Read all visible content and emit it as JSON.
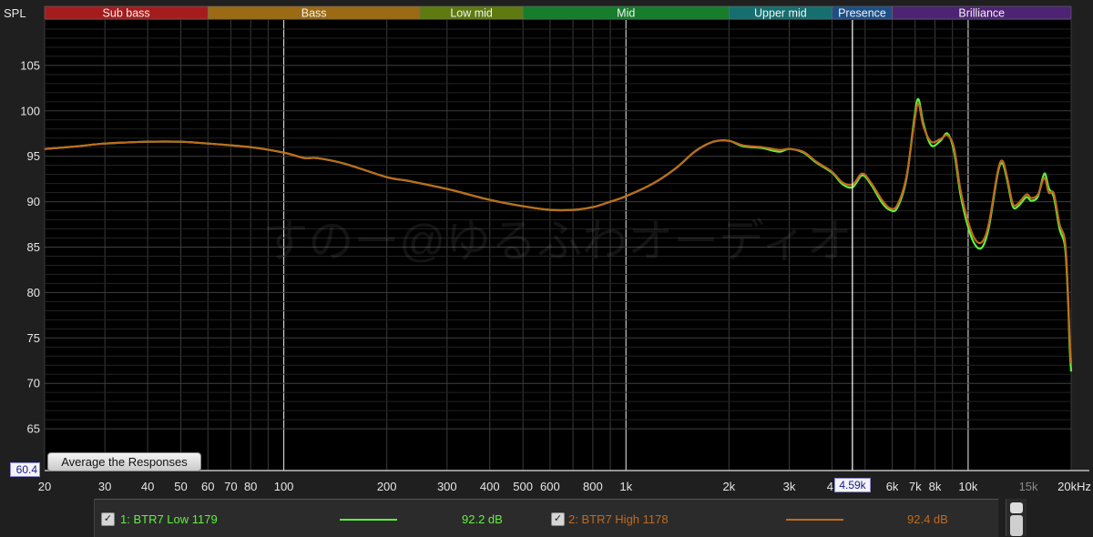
{
  "header": {
    "spl_label": "SPL",
    "bands": [
      {
        "name": "Sub bass",
        "from": 20,
        "to": 60,
        "color": "#a51c1c"
      },
      {
        "name": "Bass",
        "from": 60,
        "to": 250,
        "color": "#9b6a13"
      },
      {
        "name": "Low mid",
        "from": 250,
        "to": 500,
        "color": "#5f7b10"
      },
      {
        "name": "Mid",
        "from": 500,
        "to": 2000,
        "color": "#157d2b"
      },
      {
        "name": "Upper mid",
        "from": 2000,
        "to": 4000,
        "color": "#166f6f"
      },
      {
        "name": "Presence",
        "from": 4000,
        "to": 6000,
        "color": "#1d4f86"
      },
      {
        "name": "Brilliance",
        "from": 6000,
        "to": 20000,
        "color": "#4d2373"
      }
    ]
  },
  "controls": {
    "average_button": "Average the Responses",
    "ymin_value": "60.4",
    "cursor_freq_label": "4.59k",
    "cursor_freq": 4590
  },
  "watermark": "すのー@ゆるふわオーディオ",
  "chart_data": {
    "type": "line",
    "xscale": "log",
    "xlim": [
      20,
      20000
    ],
    "ylim": [
      60.4,
      110
    ],
    "grid": true,
    "x_ticks": [
      {
        "v": 20,
        "label": "20"
      },
      {
        "v": 30,
        "label": "30"
      },
      {
        "v": 40,
        "label": "40"
      },
      {
        "v": 50,
        "label": "50"
      },
      {
        "v": 60,
        "label": "60"
      },
      {
        "v": 70,
        "label": "70"
      },
      {
        "v": 80,
        "label": "80"
      },
      {
        "v": 100,
        "label": "100"
      },
      {
        "v": 200,
        "label": "200"
      },
      {
        "v": 300,
        "label": "300"
      },
      {
        "v": 400,
        "label": "400"
      },
      {
        "v": 500,
        "label": "500"
      },
      {
        "v": 600,
        "label": "600"
      },
      {
        "v": 800,
        "label": "800"
      },
      {
        "v": 1000,
        "label": "1k"
      },
      {
        "v": 2000,
        "label": "2k"
      },
      {
        "v": 3000,
        "label": "3k"
      },
      {
        "v": 4000,
        "label": "4"
      },
      {
        "v": 6000,
        "label": "6k"
      },
      {
        "v": 7000,
        "label": "7k"
      },
      {
        "v": 8000,
        "label": "8k"
      },
      {
        "v": 10000,
        "label": "10k"
      },
      {
        "v": 15000,
        "label": "15k",
        "dim": true
      },
      {
        "v": 20000,
        "label": "20kHz"
      }
    ],
    "y_ticks": [
      65,
      70,
      75,
      80,
      85,
      90,
      95,
      100,
      105
    ],
    "series": [
      {
        "name": "1: BTR7 Low 1179",
        "color": "#5ff23a",
        "avg_label": "92.2 dB",
        "checked": true,
        "points": [
          [
            20,
            95.8
          ],
          [
            25,
            96.1
          ],
          [
            30,
            96.4
          ],
          [
            40,
            96.6
          ],
          [
            50,
            96.6
          ],
          [
            60,
            96.4
          ],
          [
            80,
            96.0
          ],
          [
            100,
            95.4
          ],
          [
            115,
            94.8
          ],
          [
            125,
            94.8
          ],
          [
            150,
            94.2
          ],
          [
            200,
            92.7
          ],
          [
            230,
            92.3
          ],
          [
            300,
            91.4
          ],
          [
            400,
            90.2
          ],
          [
            500,
            89.5
          ],
          [
            600,
            89.1
          ],
          [
            700,
            89.1
          ],
          [
            800,
            89.4
          ],
          [
            900,
            90.0
          ],
          [
            1000,
            90.6
          ],
          [
            1200,
            92.0
          ],
          [
            1400,
            93.7
          ],
          [
            1600,
            95.6
          ],
          [
            1800,
            96.6
          ],
          [
            2000,
            96.7
          ],
          [
            2200,
            96.1
          ],
          [
            2500,
            95.9
          ],
          [
            2800,
            95.5
          ],
          [
            3000,
            95.8
          ],
          [
            3300,
            95.4
          ],
          [
            3600,
            94.3
          ],
          [
            4000,
            93.2
          ],
          [
            4300,
            91.9
          ],
          [
            4600,
            91.6
          ],
          [
            4900,
            92.9
          ],
          [
            5200,
            91.9
          ],
          [
            5600,
            89.9
          ],
          [
            5900,
            89.1
          ],
          [
            6200,
            89.3
          ],
          [
            6600,
            92.5
          ],
          [
            6950,
            99.0
          ],
          [
            7150,
            101.3
          ],
          [
            7400,
            98.6
          ],
          [
            7800,
            96.2
          ],
          [
            8300,
            96.7
          ],
          [
            8700,
            97.5
          ],
          [
            9100,
            95.5
          ],
          [
            9500,
            90.8
          ],
          [
            10000,
            87.2
          ],
          [
            10500,
            85.2
          ],
          [
            11000,
            85.0
          ],
          [
            11500,
            87.2
          ],
          [
            12200,
            93.1
          ],
          [
            12600,
            94.2
          ],
          [
            13000,
            92.4
          ],
          [
            13500,
            89.5
          ],
          [
            14000,
            89.5
          ],
          [
            14800,
            90.5
          ],
          [
            15300,
            90.1
          ],
          [
            16000,
            90.6
          ],
          [
            16700,
            93.1
          ],
          [
            17200,
            91.5
          ],
          [
            17800,
            90.5
          ],
          [
            18500,
            87.0
          ],
          [
            19200,
            85.0
          ],
          [
            19600,
            79.0
          ],
          [
            19800,
            74.0
          ],
          [
            20000,
            71.3
          ]
        ]
      },
      {
        "name": "2: BTR7 High 1178",
        "color": "#c06a1d",
        "avg_label": "92.4 dB",
        "checked": true,
        "points": [
          [
            20,
            95.8
          ],
          [
            25,
            96.1
          ],
          [
            30,
            96.4
          ],
          [
            40,
            96.6
          ],
          [
            50,
            96.6
          ],
          [
            60,
            96.4
          ],
          [
            80,
            96.0
          ],
          [
            100,
            95.4
          ],
          [
            115,
            94.8
          ],
          [
            125,
            94.8
          ],
          [
            150,
            94.2
          ],
          [
            200,
            92.7
          ],
          [
            230,
            92.3
          ],
          [
            300,
            91.4
          ],
          [
            400,
            90.2
          ],
          [
            500,
            89.5
          ],
          [
            600,
            89.1
          ],
          [
            700,
            89.1
          ],
          [
            800,
            89.4
          ],
          [
            900,
            90.0
          ],
          [
            1000,
            90.6
          ],
          [
            1200,
            92.0
          ],
          [
            1400,
            93.7
          ],
          [
            1600,
            95.6
          ],
          [
            1800,
            96.6
          ],
          [
            2000,
            96.7
          ],
          [
            2200,
            96.2
          ],
          [
            2500,
            96.0
          ],
          [
            2800,
            95.7
          ],
          [
            3000,
            95.8
          ],
          [
            3300,
            95.5
          ],
          [
            3600,
            94.4
          ],
          [
            4000,
            93.3
          ],
          [
            4300,
            92.1
          ],
          [
            4600,
            91.9
          ],
          [
            4900,
            93.1
          ],
          [
            5200,
            92.1
          ],
          [
            5600,
            90.2
          ],
          [
            5900,
            89.3
          ],
          [
            6200,
            89.6
          ],
          [
            6600,
            92.7
          ],
          [
            6950,
            98.6
          ],
          [
            7150,
            100.8
          ],
          [
            7400,
            98.3
          ],
          [
            7800,
            96.6
          ],
          [
            8300,
            96.9
          ],
          [
            8700,
            97.3
          ],
          [
            9100,
            95.9
          ],
          [
            9500,
            91.3
          ],
          [
            10000,
            87.8
          ],
          [
            10500,
            85.8
          ],
          [
            11000,
            85.6
          ],
          [
            11500,
            87.6
          ],
          [
            12200,
            93.3
          ],
          [
            12600,
            94.5
          ],
          [
            13000,
            92.7
          ],
          [
            13500,
            89.8
          ],
          [
            14000,
            89.8
          ],
          [
            14800,
            90.8
          ],
          [
            15300,
            90.4
          ],
          [
            16000,
            90.8
          ],
          [
            16700,
            92.6
          ],
          [
            17200,
            91.0
          ],
          [
            17800,
            90.9
          ],
          [
            18500,
            87.5
          ],
          [
            19200,
            85.6
          ],
          [
            19600,
            79.5
          ],
          [
            19800,
            75.0
          ],
          [
            20000,
            72.2
          ]
        ]
      }
    ]
  }
}
